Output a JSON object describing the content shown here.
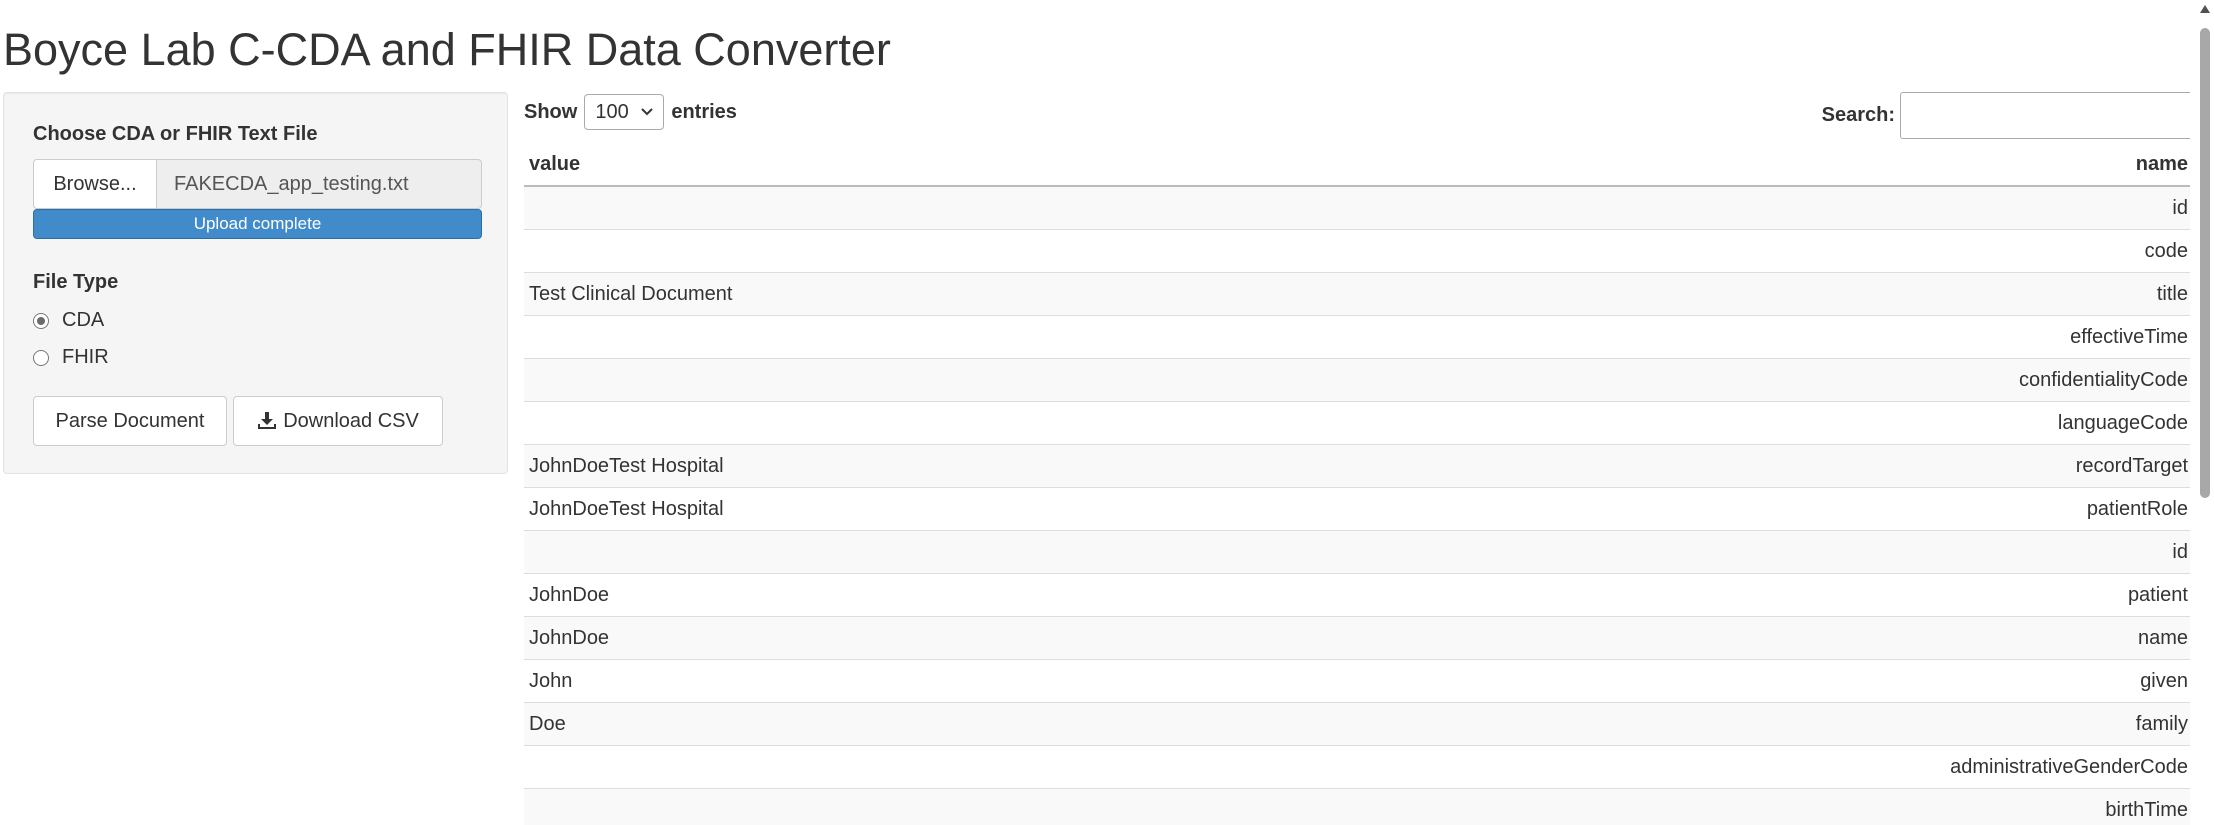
{
  "app": {
    "title": "Boyce Lab C-CDA and FHIR Data Converter"
  },
  "sidebar": {
    "file_label": "Choose CDA or FHIR Text File",
    "browse_label": "Browse...",
    "file_name": "FAKECDA_app_testing.txt",
    "upload_status": "Upload complete",
    "upload_progress": 1.0,
    "file_type_label": "File Type",
    "file_types": [
      {
        "label": "CDA",
        "checked": true
      },
      {
        "label": "FHIR",
        "checked": false
      }
    ],
    "parse_label": "Parse Document",
    "download_label": "Download CSV",
    "download_icon": "download-icon"
  },
  "table_controls": {
    "show_label": "Show",
    "entries_value": "100",
    "entries_label": "entries",
    "search_label": "Search:",
    "search_value": ""
  },
  "table": {
    "columns": [
      "value",
      "name"
    ],
    "rows": [
      {
        "value": "",
        "name": "id"
      },
      {
        "value": "",
        "name": "code"
      },
      {
        "value": "Test Clinical Document",
        "name": "title"
      },
      {
        "value": "",
        "name": "effectiveTime"
      },
      {
        "value": "",
        "name": "confidentialityCode"
      },
      {
        "value": "",
        "name": "languageCode"
      },
      {
        "value": "JohnDoeTest Hospital",
        "name": "recordTarget"
      },
      {
        "value": "JohnDoeTest Hospital",
        "name": "patientRole"
      },
      {
        "value": "",
        "name": "id"
      },
      {
        "value": "JohnDoe",
        "name": "patient"
      },
      {
        "value": "JohnDoe",
        "name": "name"
      },
      {
        "value": "John",
        "name": "given"
      },
      {
        "value": "Doe",
        "name": "family"
      },
      {
        "value": "",
        "name": "administrativeGenderCode"
      },
      {
        "value": "",
        "name": "birthTime"
      }
    ]
  },
  "colors": {
    "progress": "#337ab7",
    "row_stripe": "#f9f9f9",
    "well_bg": "#f5f5f5"
  }
}
